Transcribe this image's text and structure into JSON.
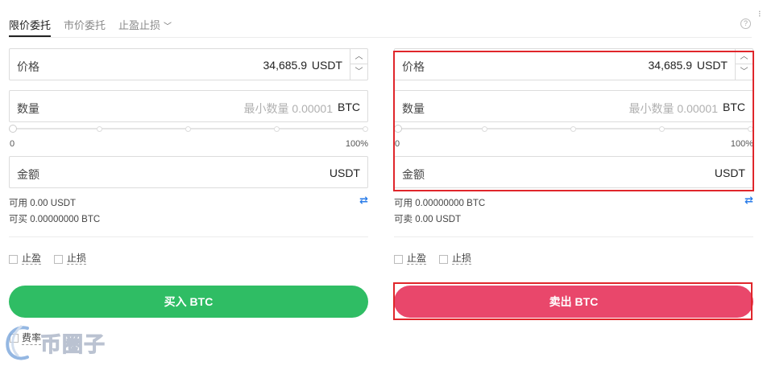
{
  "tabs": [
    {
      "label": "限价委托",
      "active": true
    },
    {
      "label": "市价委托",
      "active": false
    },
    {
      "label": "止盈止损",
      "active": false
    }
  ],
  "help_icon_glyph": "?",
  "buy": {
    "price_label": "价格",
    "price_value": "34,685.9",
    "price_unit": "USDT",
    "qty_label": "数量",
    "qty_placeholder": "最小数量 0.00001",
    "qty_unit": "BTC",
    "slider_min": "0",
    "slider_max": "100%",
    "amount_label": "金额",
    "amount_unit": "USDT",
    "available": "可用 0.00 USDT",
    "can_trade": "可买 0.00000000 BTC",
    "take_profit": "止盈",
    "stop_loss": "止损",
    "action": "买入 BTC",
    "action_color": "#2fbd64"
  },
  "sell": {
    "price_label": "价格",
    "price_value": "34,685.9",
    "price_unit": "USDT",
    "qty_label": "数量",
    "qty_placeholder": "最小数量 0.00001",
    "qty_unit": "BTC",
    "slider_min": "0",
    "slider_max": "100%",
    "amount_label": "金额",
    "amount_unit": "USDT",
    "available": "可用 0.00000000 BTC",
    "can_trade": "可卖 0.00 USDT",
    "take_profit": "止盈",
    "stop_loss": "止损",
    "action": "卖出 BTC",
    "action_color": "#e9476b"
  },
  "stepper": {
    "up": "︿",
    "down": "﹀"
  },
  "swap_icon_glyph": "⇄",
  "fee_label": "费率",
  "highlight_color": "#e0262b",
  "watermark_text": "币圈子"
}
